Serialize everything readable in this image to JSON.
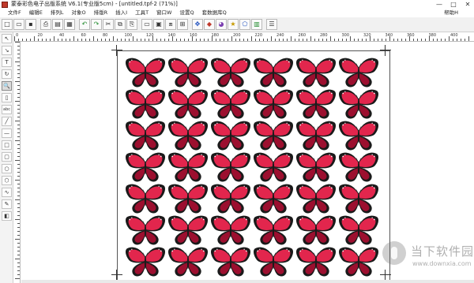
{
  "window": {
    "title": "蒙泰彩色电子出版系统 V6.1(专业版5cm) - [untitled.tpf-2 (71%)]",
    "controls": {
      "minimize": "—",
      "maximize": "□",
      "close": "✕"
    }
  },
  "menubar": {
    "items": [
      "文件F",
      "编辑E",
      "排列L",
      "对象O",
      "排版R",
      "插入I",
      "工具T",
      "窗口W",
      "设置Q",
      "套数据库Q"
    ],
    "help": "帮助H"
  },
  "toolbar": {
    "buttons": [
      {
        "name": "new",
        "glyph": "□"
      },
      {
        "name": "open",
        "glyph": "▭"
      },
      {
        "name": "save",
        "glyph": "▪"
      },
      {
        "name": "sep1",
        "glyph": ""
      },
      {
        "name": "print",
        "glyph": "⎙"
      },
      {
        "name": "print-preview",
        "glyph": "▤"
      },
      {
        "name": "output",
        "glyph": "▦"
      },
      {
        "name": "sep2",
        "glyph": ""
      },
      {
        "name": "undo",
        "glyph": "↶"
      },
      {
        "name": "redo",
        "glyph": "↷"
      },
      {
        "name": "cut",
        "glyph": "✂"
      },
      {
        "name": "copy",
        "glyph": "⧉"
      },
      {
        "name": "paste",
        "glyph": "⎘"
      },
      {
        "name": "sep3",
        "glyph": ""
      },
      {
        "name": "text-frame",
        "glyph": "▭"
      },
      {
        "name": "import-image",
        "glyph": "▣"
      },
      {
        "name": "link",
        "glyph": "⧈"
      },
      {
        "name": "table",
        "glyph": "⊞"
      },
      {
        "name": "sep4",
        "glyph": ""
      },
      {
        "name": "move",
        "glyph": "✥"
      },
      {
        "name": "color",
        "glyph": "◆"
      },
      {
        "name": "palette",
        "glyph": "◕"
      },
      {
        "name": "star",
        "glyph": "★"
      },
      {
        "name": "shape",
        "glyph": "⬠"
      },
      {
        "name": "chart",
        "glyph": "▥"
      },
      {
        "name": "sep5",
        "glyph": ""
      },
      {
        "name": "grid",
        "glyph": "☰"
      }
    ],
    "accent": "#1f8a2b"
  },
  "ruler": {
    "labels": [
      "0",
      "20",
      "40",
      "60",
      "80",
      "100",
      "120",
      "140",
      "160",
      "180",
      "200",
      "220",
      "240",
      "260",
      "280",
      "300",
      "320",
      "340",
      "360",
      "380",
      "400"
    ]
  },
  "palette": {
    "tools": [
      {
        "name": "select-tool",
        "glyph": "↖",
        "active": false
      },
      {
        "name": "node-tool",
        "glyph": "↘",
        "active": false
      },
      {
        "name": "text-tool",
        "glyph": "T",
        "active": false
      },
      {
        "name": "rotate-tool",
        "glyph": "↻",
        "active": false
      },
      {
        "name": "zoom-tool",
        "glyph": "🔍",
        "active": true
      },
      {
        "name": "frame-tool",
        "glyph": "▯",
        "active": false
      },
      {
        "name": "abc-tool",
        "glyph": "abc",
        "active": false
      },
      {
        "name": "line-tool",
        "glyph": "╱",
        "active": false
      },
      {
        "name": "hline-tool",
        "glyph": "—",
        "active": false
      },
      {
        "name": "rect-tool",
        "glyph": "□",
        "active": false
      },
      {
        "name": "roundrect-tool",
        "glyph": "▢",
        "active": false
      },
      {
        "name": "ellipse-tool",
        "glyph": "○",
        "active": false
      },
      {
        "name": "polygon-tool",
        "glyph": "⬡",
        "active": false
      },
      {
        "name": "curve-tool",
        "glyph": "∿",
        "active": false
      },
      {
        "name": "pen-tool",
        "glyph": "✎",
        "active": false
      },
      {
        "name": "fill-tool",
        "glyph": "◧",
        "active": false
      }
    ]
  },
  "canvas": {
    "zoom": "71%",
    "butterfly_rows": 7,
    "butterfly_cols": 6,
    "butterfly_colors": {
      "wing": "#e2264d",
      "wing_dark": "#9c0f2f",
      "edge": "#1a1a1a",
      "spot": "#ffffff"
    }
  },
  "watermark": {
    "text": "当下软件园",
    "sub": "www.downxia.com"
  }
}
